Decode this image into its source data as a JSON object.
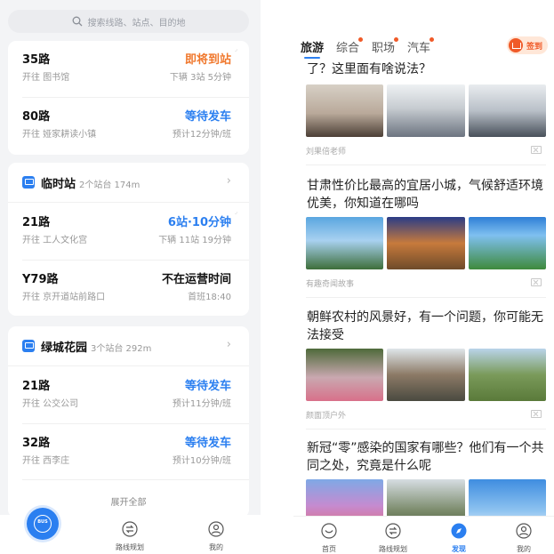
{
  "left": {
    "search": {
      "placeholder": "搜索线路、站点、目的地"
    },
    "top_card": {
      "rows": [
        {
          "line": "35路",
          "to": "开往 图书馆",
          "status": "即将到站",
          "status_color": "#f0782d",
          "sub": "下辆 3站 5分钟"
        },
        {
          "line": "80路",
          "to": "开往 娅家耕读小镇",
          "status": "等待发车",
          "status_color": "#2b7ff0",
          "sub": "预计12分钟/班"
        }
      ]
    },
    "station1": {
      "name": "临时站",
      "meta": "2个站台 174m",
      "rows": [
        {
          "line": "21路",
          "to": "开往 工人文化宫",
          "status": "6站·10分钟",
          "status_color": "#2b7ff0",
          "sub": "下辆 11站 19分钟"
        },
        {
          "line": "Y79路",
          "to": "开往 京开道站前路口",
          "status": "不在运营时间",
          "status_color": "#111111",
          "sub": "首班18:40"
        }
      ]
    },
    "station2": {
      "name": "绿城花园",
      "meta": "3个站台 292m",
      "rows": [
        {
          "line": "21路",
          "to": "开往 公交公司",
          "status": "等待发车",
          "status_color": "#2b7ff0",
          "sub": "预计11分钟/班"
        },
        {
          "line": "32路",
          "to": "开往 西李庄",
          "status": "等待发车",
          "status_color": "#2b7ff0",
          "sub": "预计10分钟/班"
        }
      ],
      "expand": "展开全部"
    },
    "nav": {
      "bus": "BUS",
      "route": "路线规划",
      "mine": "我的"
    }
  },
  "right": {
    "tabs": [
      {
        "label": "旅游",
        "active": true,
        "dot": false
      },
      {
        "label": "综合",
        "active": false,
        "dot": true
      },
      {
        "label": "职场",
        "active": false,
        "dot": true
      },
      {
        "label": "汽车",
        "active": false,
        "dot": true
      }
    ],
    "signin": "签到",
    "articles": [
      {
        "title": "了？这里面有啥说法？",
        "source": "刘果倍老师"
      },
      {
        "title": "甘肃性价比最高的宜居小城，气候舒适环境优美，你知道在哪吗",
        "source": "有趣奇闻故事"
      },
      {
        "title": "朝鲜农村的风景好，有一个问题，你可能无法接受",
        "source": "颜面顶户外"
      },
      {
        "title": "新冠“零”感染的国家有哪些？他们有一个共同之处，究竟是什么呢",
        "source": ""
      }
    ],
    "nav": {
      "home": "首页",
      "route": "路线规划",
      "discover": "发现",
      "mine": "我的"
    }
  },
  "colors": {
    "accent": "#2b7ff0",
    "orange": "#f0782d",
    "badge": "#f05a28"
  }
}
